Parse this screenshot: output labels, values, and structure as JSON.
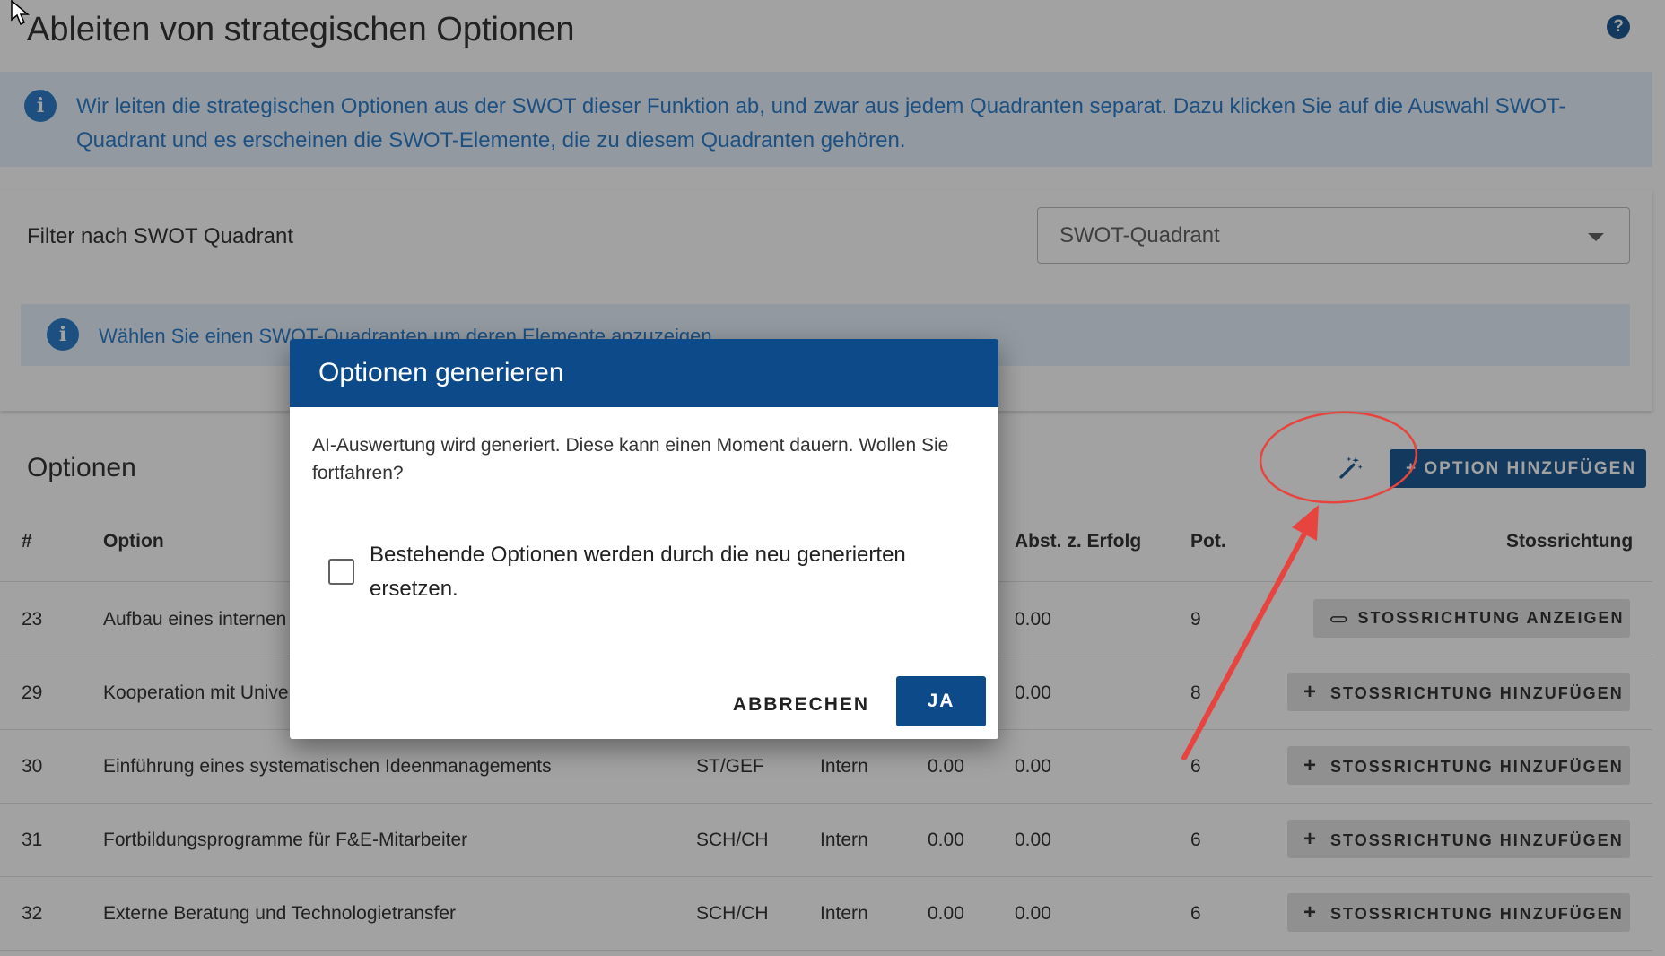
{
  "page": {
    "title": "Ableiten von strategischen Optionen",
    "help_icon_glyph": "?",
    "info_text": "Wir leiten die strategischen Optionen aus der SWOT dieser Funktion ab, und zwar aus jedem Quadranten separat. Dazu klicken Sie auf die Auswahl SWOT-Quadrant und es erscheinen die SWOT-Elemente, die zu diesem Quadranten gehören."
  },
  "filter": {
    "label": "Filter nach SWOT Quadrant",
    "select_value": "SWOT-Quadrant",
    "hint": "Wählen Sie einen SWOT-Quadranten um deren Elemente anzuzeigen"
  },
  "options": {
    "title": "Optionen",
    "add_button": "+ OPTION HINZUFÜGEN",
    "columns": {
      "num": "#",
      "option": "Option",
      "distance": "Abst. z. Erfolg",
      "potential": "Pot.",
      "direction": "Stossrichtung"
    },
    "rows": [
      {
        "num": "23",
        "option": "Aufbau eines internen",
        "quad": "",
        "type": "",
        "val1": "",
        "val2": "0.00",
        "pot": "9",
        "action": "STOSSRICHTUNG ANZEIGEN",
        "action_icon": "link-icon"
      },
      {
        "num": "29",
        "option": "Kooperation mit Unive",
        "quad": "",
        "type": "",
        "val1": "",
        "val2": "0.00",
        "pot": "8",
        "action": "STOSSRICHTUNG HINZUFÜGEN",
        "action_icon": "plus-icon"
      },
      {
        "num": "30",
        "option": "Einführung eines systematischen Ideenmanagements",
        "quad": "ST/GEF",
        "type": "Intern",
        "val1": "0.00",
        "val2": "0.00",
        "pot": "6",
        "action": "STOSSRICHTUNG HINZUFÜGEN",
        "action_icon": "plus-icon"
      },
      {
        "num": "31",
        "option": "Fortbildungsprogramme für F&E-Mitarbeiter",
        "quad": "SCH/CH",
        "type": "Intern",
        "val1": "0.00",
        "val2": "0.00",
        "pot": "6",
        "action": "STOSSRICHTUNG HINZUFÜGEN",
        "action_icon": "plus-icon"
      },
      {
        "num": "32",
        "option": "Externe Beratung und Technologietransfer",
        "quad": "SCH/CH",
        "type": "Intern",
        "val1": "0.00",
        "val2": "0.00",
        "pot": "6",
        "action": "STOSSRICHTUNG HINZUFÜGEN",
        "action_icon": "plus-icon"
      }
    ]
  },
  "dialog": {
    "title": "Optionen generieren",
    "body": "AI-Auswertung wird generiert. Diese kann einen Moment dauern. Wollen Sie fortfahren?",
    "checkbox_label": "Bestehende Optionen werden durch die neu generierten ersetzen.",
    "checkbox_checked": false,
    "cancel": "ABBRECHEN",
    "confirm": "JA"
  },
  "colors": {
    "primary": "#0c4a8a",
    "info_bg": "#e4f0fb",
    "info_text": "#1a73c7",
    "annotation": "#e8443f"
  }
}
